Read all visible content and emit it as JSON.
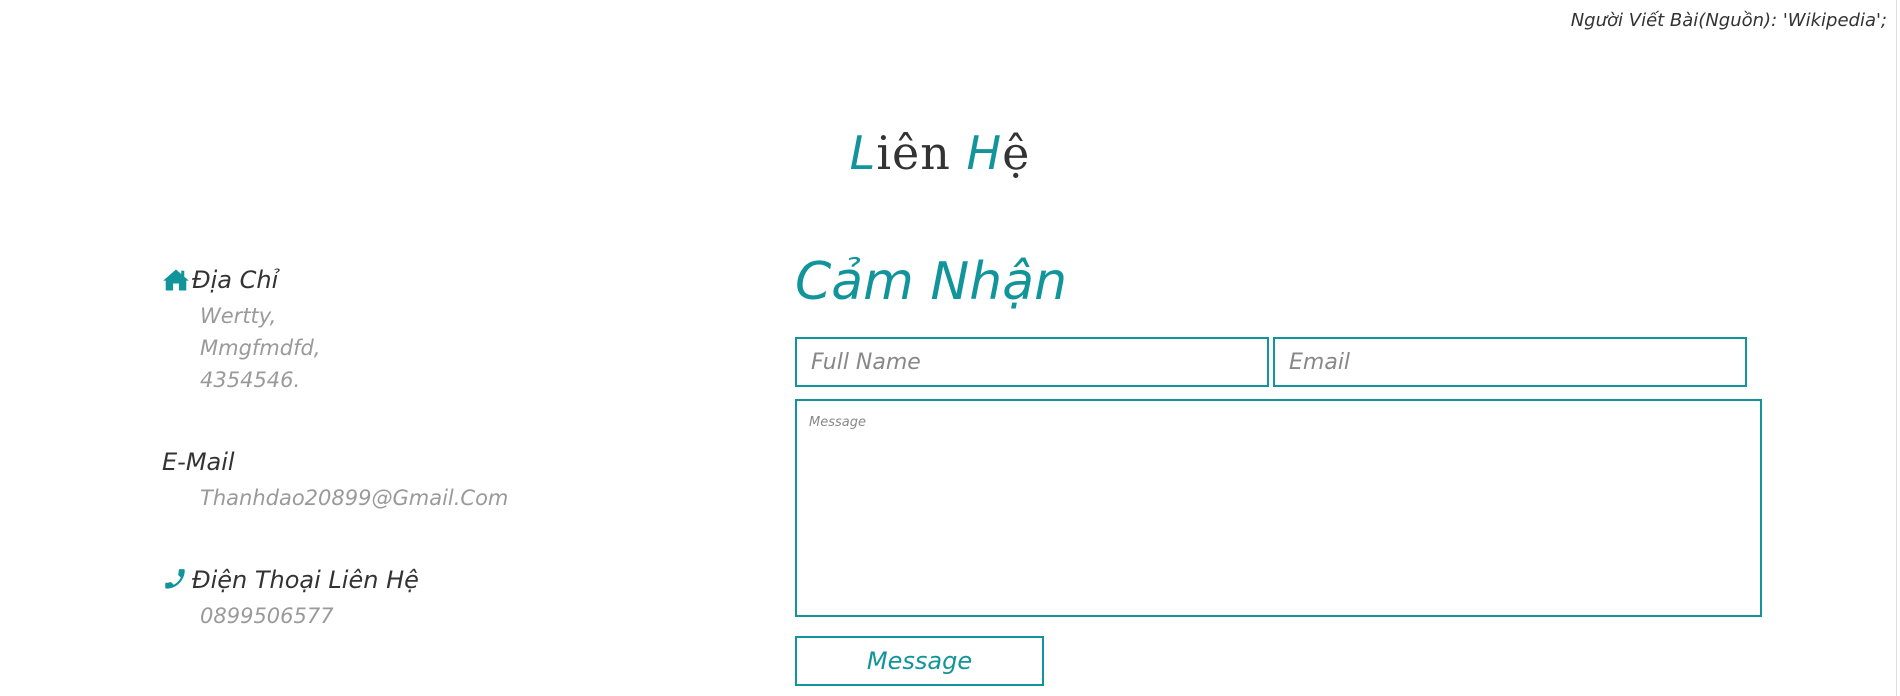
{
  "header": {
    "author_credit": "Người Viết Bài(Nguồn): 'Wikipedia';"
  },
  "page_title": {
    "letter1": "L",
    "part1": "iên ",
    "letter2": "H",
    "part2": "ệ"
  },
  "contact": {
    "address": {
      "icon": "home-icon",
      "heading": "Địa Chỉ",
      "lines": [
        "Wertty,",
        "Mmgfmdfd,",
        "4354546."
      ]
    },
    "email": {
      "heading": "E-Mail",
      "value": "Thanhdao20899@Gmail.Com"
    },
    "phone": {
      "icon": "phone-icon",
      "heading": "Điện Thoại Liên Hệ",
      "value": "0899506577"
    }
  },
  "form": {
    "title": "Cảm Nhận",
    "name_placeholder": "Full Name",
    "email_placeholder": "Email",
    "message_placeholder": "Message",
    "submit_label": "Message"
  },
  "colors": {
    "accent": "#11959a",
    "text": "#333333",
    "muted": "#9a9a9a"
  }
}
